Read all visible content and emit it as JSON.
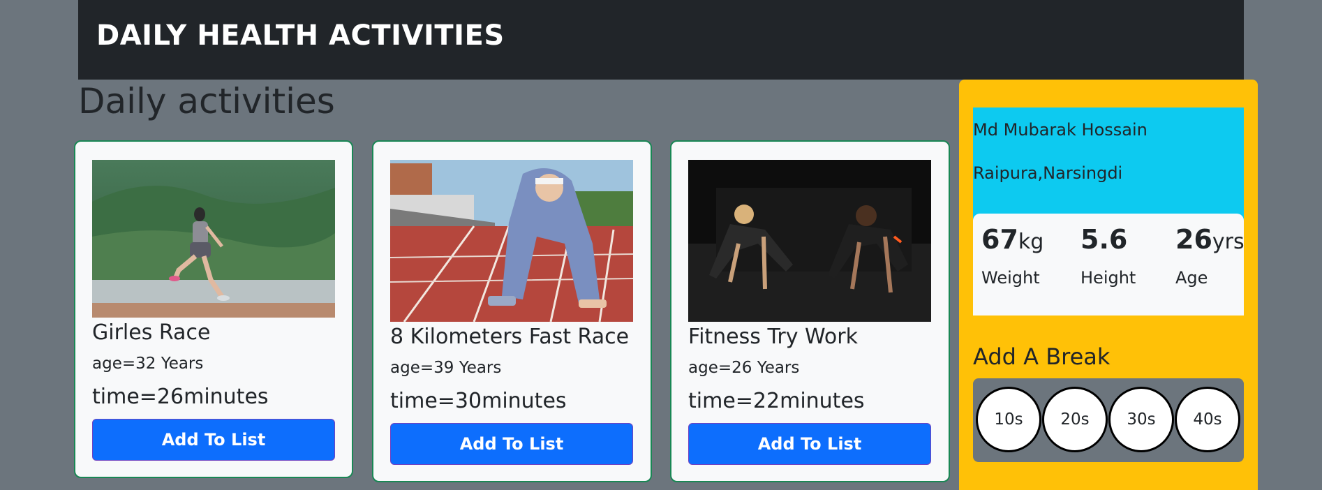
{
  "header": {
    "title": "DAILY HEALTH ACTIVITIES"
  },
  "main": {
    "section_title": "Daily activities",
    "cards": [
      {
        "title": "Girles Race",
        "age": "age=32 Years",
        "time": "time=26minutes",
        "button": "Add To List"
      },
      {
        "title": "8 Kilometers Fast Race",
        "age": "age=39 Years",
        "time": "time=30minutes",
        "button": "Add To List"
      },
      {
        "title": "Fitness Try Work",
        "age": "age=26 Years",
        "time": "time=22minutes",
        "button": "Add To List"
      }
    ]
  },
  "sidebar": {
    "name": "Md Mubarak Hossain",
    "address": "Raipura,Narsingdi",
    "stats": [
      {
        "value": "67",
        "unit": "kg",
        "label": "Weight"
      },
      {
        "value": "5.6",
        "unit": "",
        "label": "Height"
      },
      {
        "value": "26",
        "unit": "yrs",
        "label": "Age"
      }
    ],
    "break_title": "Add A Break",
    "breaks": [
      "10s",
      "20s",
      "30s",
      "40s"
    ]
  },
  "colors": {
    "page_bg": "#6c757d",
    "navbar_bg": "#212529",
    "card_border": "#198754",
    "button": "#0d6efd",
    "sidebar_bg": "#ffc107",
    "profile_bg": "#0dcaf0"
  }
}
